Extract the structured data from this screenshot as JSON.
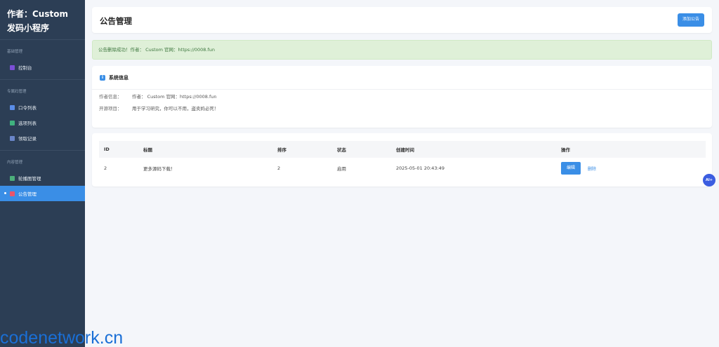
{
  "sidebar": {
    "brand_line1": "作者：Custom",
    "brand_line2": "发码小程序",
    "sections": [
      {
        "title": "基础管理",
        "items": [
          {
            "label": "控制台",
            "icon": "dashboard-icon",
            "color": "#7b4fd6"
          }
        ]
      },
      {
        "title": "专属码管理",
        "items": [
          {
            "label": "口令列表",
            "icon": "list-icon",
            "color": "#5a8de8"
          },
          {
            "label": "选项列表",
            "icon": "checkbox-icon",
            "color": "#3fb27f"
          },
          {
            "label": "领取记录",
            "icon": "calendar-icon",
            "color": "#6a86c9"
          }
        ]
      },
      {
        "title": "内容管理",
        "items": [
          {
            "label": "轮播图管理",
            "icon": "image-icon",
            "color": "#4caf7a"
          },
          {
            "label": "公告管理",
            "icon": "megaphone-icon",
            "color": "#e9556b",
            "active": true
          }
        ]
      }
    ]
  },
  "header": {
    "title": "公告管理",
    "add_button": "添加公告"
  },
  "alert": {
    "text": "公告删除成功！作者： Custom 官网：https://0008.fun"
  },
  "system_info": {
    "icon": "i",
    "title": "系统信息",
    "rows": [
      {
        "label": "作者信息：",
        "value": "作者： Custom 官网：https://0008.fun"
      },
      {
        "label": "开源项目：",
        "value": "用于学习研究，你可以不用，盗卖妈必死！"
      }
    ]
  },
  "table": {
    "headers": [
      "ID",
      "标题",
      "排序",
      "状态",
      "创建时间",
      "操作"
    ],
    "rows": [
      {
        "id": "2",
        "title": "更多源码下载！",
        "sort": "2",
        "status": "启用",
        "created": "2025-05-01 20:43:49",
        "edit": "编辑",
        "delete": "删除"
      }
    ]
  },
  "fab": {
    "label": "AI+"
  },
  "watermark": "codenetwork.cn",
  "colors": {
    "sidebar_bg": "#2c3e55",
    "accent": "#3a8ee6",
    "alert_bg": "#dff0d8",
    "alert_text": "#3c763d"
  }
}
